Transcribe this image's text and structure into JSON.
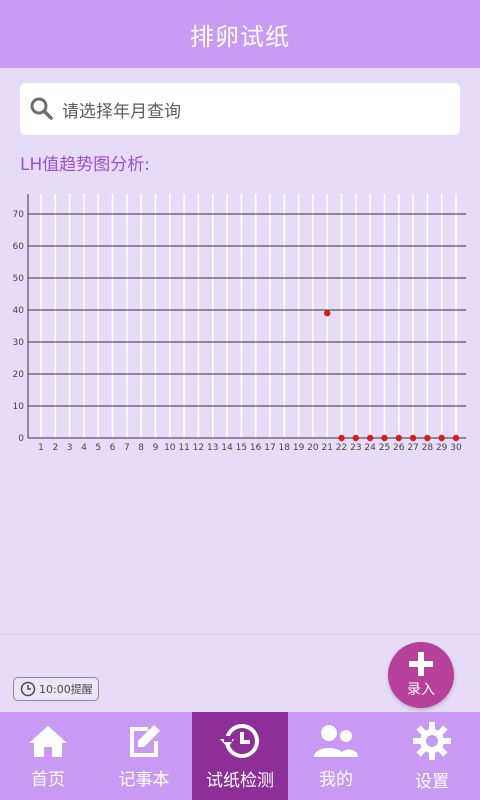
{
  "header": {
    "title": "排卵试纸"
  },
  "search": {
    "placeholder": "请选择年月查询"
  },
  "chart_section": {
    "heading": "LH值趋势图分析:"
  },
  "chart_data": {
    "type": "scatter",
    "x": [
      21,
      22,
      23,
      24,
      25,
      26,
      27,
      28,
      29,
      30
    ],
    "y": [
      39,
      0,
      0,
      0,
      0,
      0,
      0,
      0,
      0,
      0
    ],
    "x_ticks": [
      "1",
      "2",
      "3",
      "4",
      "5",
      "6",
      "7",
      "8",
      "9",
      "10",
      "11",
      "12",
      "13",
      "14",
      "15",
      "16",
      "17",
      "18",
      "19",
      "20",
      "21",
      "22",
      "23",
      "24",
      "25",
      "26",
      "27",
      "28",
      "29",
      "30"
    ],
    "y_ticks": [
      "0",
      "10",
      "20",
      "30",
      "40",
      "50",
      "60",
      "70"
    ],
    "xlim": [
      1,
      30
    ],
    "ylim": [
      0,
      70
    ],
    "grid": true,
    "point_color": "#d81b1b"
  },
  "reminder": {
    "label": "10:00提醒"
  },
  "fab": {
    "label": "录入"
  },
  "tabbar": {
    "items": [
      {
        "label": "首页",
        "icon": "home-icon"
      },
      {
        "label": "记事本",
        "icon": "edit-icon"
      },
      {
        "label": "试纸检测",
        "icon": "history-icon",
        "active": true
      },
      {
        "label": "我的",
        "icon": "users-icon"
      },
      {
        "label": "设置",
        "icon": "gear-icon"
      }
    ]
  }
}
